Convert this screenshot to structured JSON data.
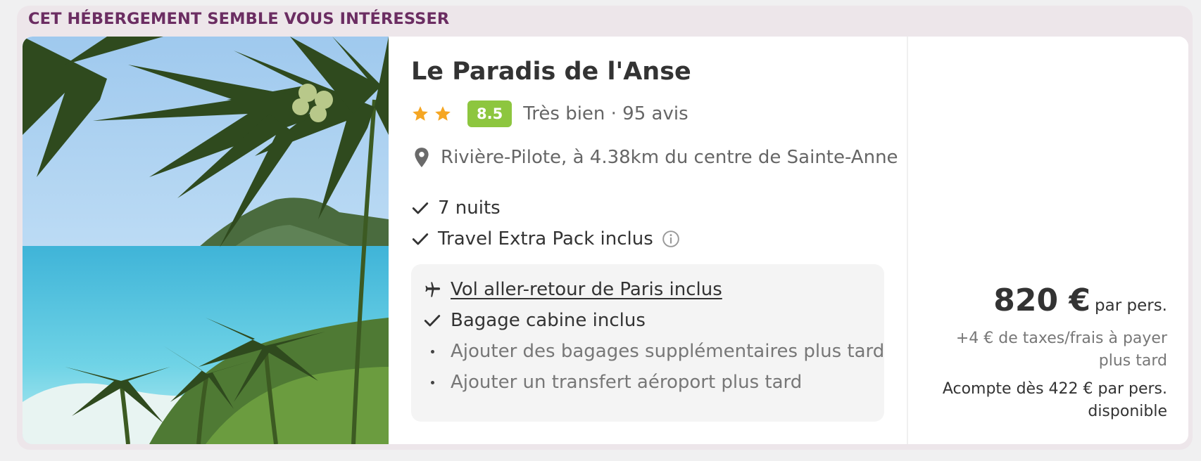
{
  "banner": "CET HÉBERGEMENT SEMBLE VOUS INTÉRESSER",
  "hotel": {
    "name": "Le Paradis de l'Anse",
    "stars": 2,
    "score": "8.5",
    "rating_text": "Très bien · 95 avis",
    "location": "Rivière-Pilote, à 4.38km du centre de Sainte-Anne",
    "features": [
      "7 nuits",
      "Travel Extra Pack inclus"
    ]
  },
  "flight": {
    "headline": "Vol aller-retour de Paris inclus",
    "included": "Bagage cabine inclus",
    "options": [
      "Ajouter des bagages supplémentaires plus tard",
      "Ajouter un transfert aéroport plus tard"
    ]
  },
  "price": {
    "amount": "820 €",
    "per": "par pers.",
    "taxes": "+4 € de taxes/frais à payer plus tard",
    "deposit": "Acompte dès 422 € par pers. disponible"
  },
  "colors": {
    "banner": "#6b2d62",
    "score_badge": "#8dc63f",
    "star": "#f5a623"
  },
  "icons": [
    "star-icon",
    "location-pin-icon",
    "check-icon",
    "info-icon",
    "plane-icon",
    "bullet-icon"
  ]
}
